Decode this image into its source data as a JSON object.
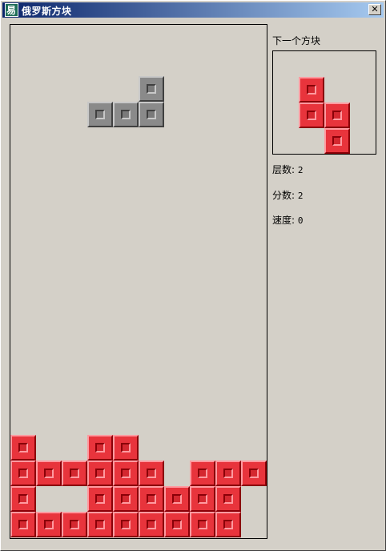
{
  "window": {
    "title": "俄罗斯方块",
    "close_glyph": "✕",
    "icon_glyph": "易"
  },
  "sidebar": {
    "next_label": "下一个方块",
    "level_label": "层数:",
    "level_value": "2",
    "score_label": "分数:",
    "score_value": "2",
    "speed_label": "速度:",
    "speed_value": "0"
  },
  "colors": {
    "active_piece": "#8a8a8a",
    "settled": "#e8343c",
    "next_piece": "#e8343c"
  },
  "board": {
    "cols": 10,
    "rows": 20,
    "active_piece": [
      [
        5,
        2
      ],
      [
        3,
        3
      ],
      [
        4,
        3
      ],
      [
        5,
        3
      ]
    ],
    "settled": [
      [
        0,
        16
      ],
      [
        3,
        16
      ],
      [
        4,
        16
      ],
      [
        0,
        17
      ],
      [
        1,
        17
      ],
      [
        2,
        17
      ],
      [
        3,
        17
      ],
      [
        4,
        17
      ],
      [
        5,
        17
      ],
      [
        7,
        17
      ],
      [
        8,
        17
      ],
      [
        9,
        17
      ],
      [
        0,
        18
      ],
      [
        3,
        18
      ],
      [
        4,
        18
      ],
      [
        5,
        18
      ],
      [
        6,
        18
      ],
      [
        7,
        18
      ],
      [
        8,
        18
      ],
      [
        0,
        19
      ],
      [
        1,
        19
      ],
      [
        2,
        19
      ],
      [
        3,
        19
      ],
      [
        4,
        19
      ],
      [
        5,
        19
      ],
      [
        6,
        19
      ],
      [
        7,
        19
      ],
      [
        8,
        19
      ]
    ]
  },
  "next_piece": [
    [
      1,
      1
    ],
    [
      1,
      2
    ],
    [
      2,
      2
    ],
    [
      2,
      3
    ]
  ]
}
